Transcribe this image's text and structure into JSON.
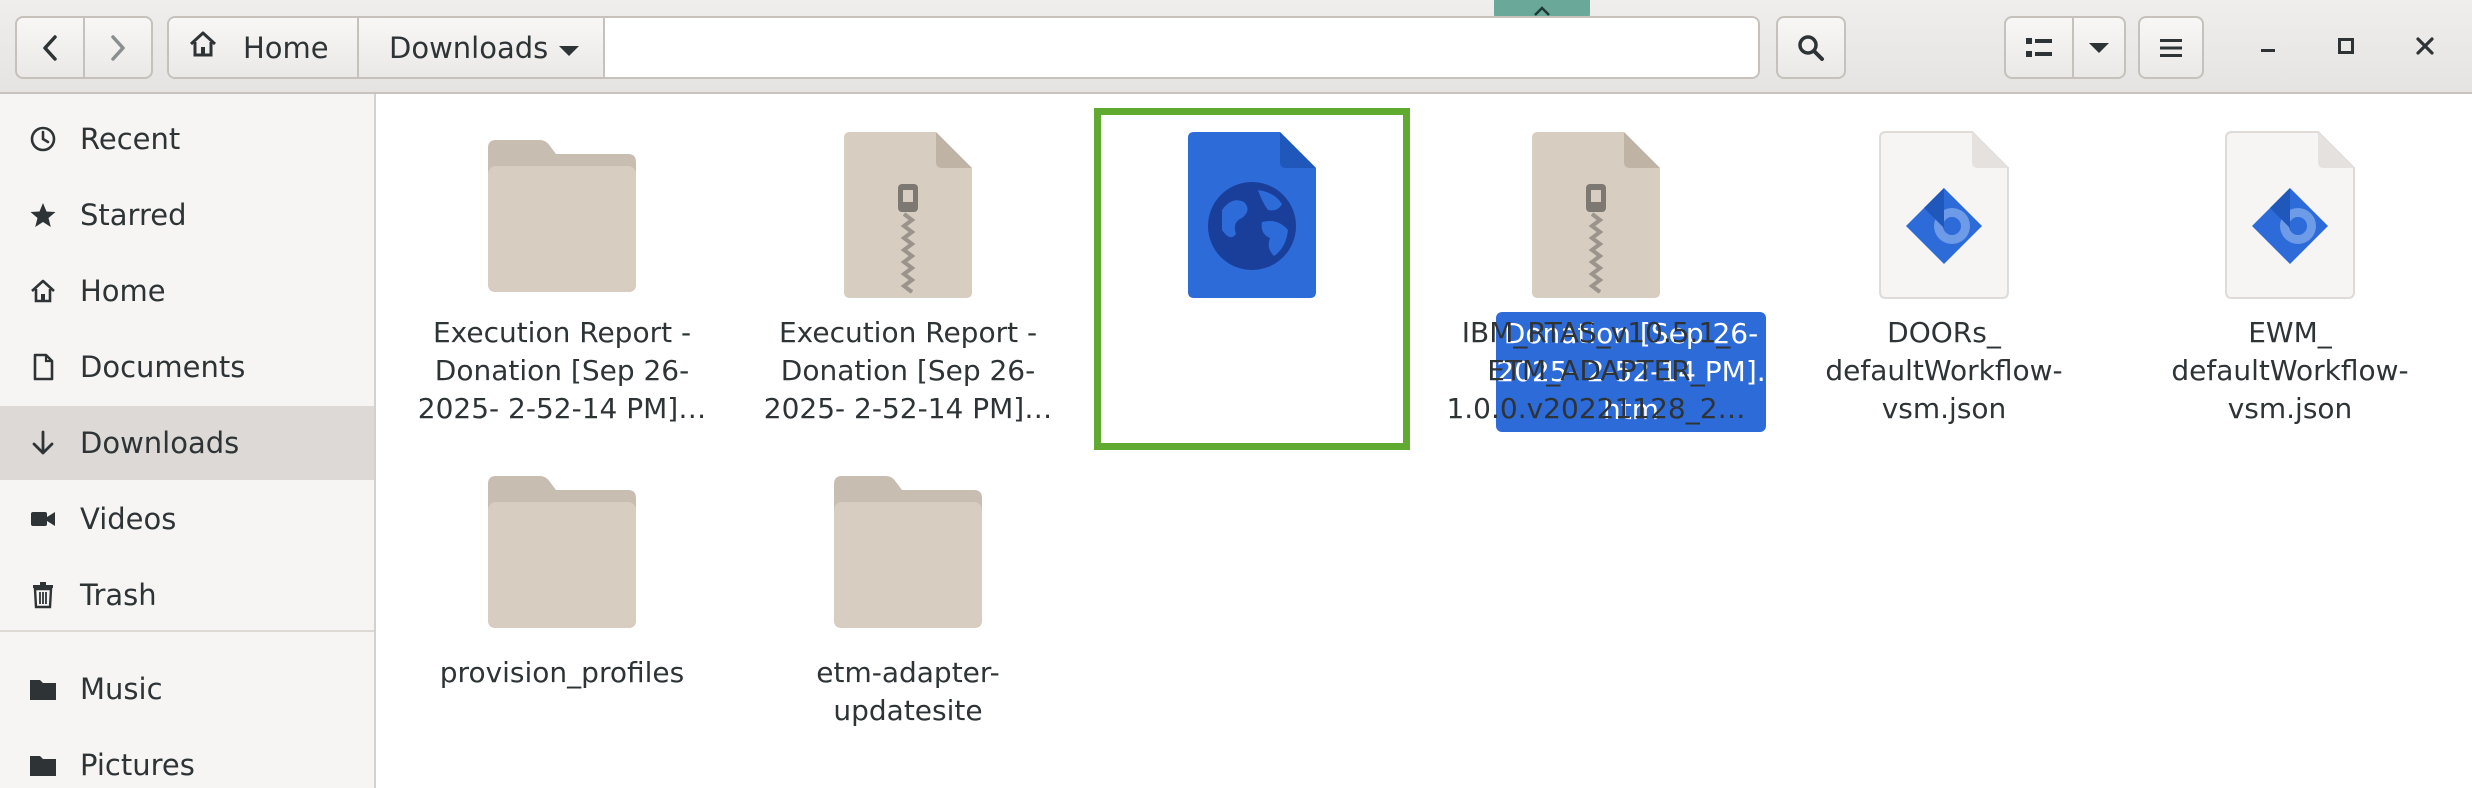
{
  "nav": {
    "back_icon": "go-back-icon",
    "forward_icon": "go-forward-icon"
  },
  "pathbar": {
    "home_label": "Home",
    "current_label": "Downloads"
  },
  "toolbar": {
    "search_icon": "search-icon",
    "view_icon": "list-view-icon",
    "menu_icon": "hamburger-menu-icon"
  },
  "sidebar": {
    "items": [
      {
        "label": "Recent",
        "icon": "clock-icon"
      },
      {
        "label": "Starred",
        "icon": "star-icon"
      },
      {
        "label": "Home",
        "icon": "home-icon"
      },
      {
        "label": "Documents",
        "icon": "document-icon"
      },
      {
        "label": "Downloads",
        "icon": "download-icon",
        "active": true
      },
      {
        "label": "Videos",
        "icon": "video-icon"
      },
      {
        "label": "Trash",
        "icon": "trash-icon"
      },
      {
        "label": "Music",
        "icon": "folder-icon"
      },
      {
        "label": "Pictures",
        "icon": "folder-icon"
      }
    ]
  },
  "files": [
    {
      "type": "folder",
      "lines": [
        "Execution Report -",
        "Donation [Sep 26-",
        "2025- 2-52-14 PM]…"
      ]
    },
    {
      "type": "archive",
      "lines": [
        "Execution Report -",
        "Donation [Sep 26-",
        "2025- 2-52-14 PM]…"
      ]
    },
    {
      "type": "html",
      "selected": true,
      "lines": [
        "Donation [Sep 26-",
        "2025- 2-52-14 PM].",
        "htm"
      ]
    },
    {
      "type": "archive",
      "lines": [
        "IBM_RTAS_v10.5.1_",
        "ETM_ADAPTER_",
        "1.0.0.v20221128_2…"
      ]
    },
    {
      "type": "json",
      "lines": [
        "DOORs_",
        "defaultWorkflow-",
        "vsm.json"
      ]
    },
    {
      "type": "json",
      "lines": [
        "EWM_",
        "defaultWorkflow-",
        "vsm.json"
      ]
    },
    {
      "type": "folder",
      "lines": [
        "provision_profiles"
      ]
    },
    {
      "type": "folder",
      "lines": [
        "etm-adapter-",
        "updatesite"
      ]
    }
  ],
  "colors": {
    "selection": "#2d6bd8",
    "selection_frame": "#5faa2f",
    "folder": "#d8cdc1",
    "html_file": "#2d6bd8"
  }
}
